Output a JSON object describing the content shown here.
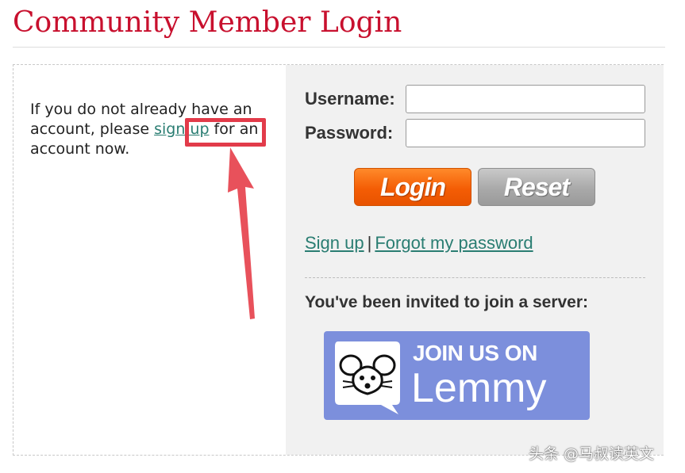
{
  "header": {
    "title": "Community Member Login"
  },
  "intro": {
    "text_before": "If you do not already have an account, please ",
    "signup_link": "sign up",
    "text_after": " for an account now."
  },
  "form": {
    "username_label": "Username:",
    "password_label": "Password:",
    "username_value": "",
    "password_value": "",
    "login_button": "Login",
    "reset_button": "Reset"
  },
  "links": {
    "signup": "Sign up",
    "separator": "|",
    "forgot": "Forgot my password"
  },
  "invite": {
    "text": "You've been invited to join a server:",
    "banner_line1": "JOIN US ON",
    "banner_line2": "Lemmy",
    "banner_icon": "lemmy-mouse-icon"
  },
  "annotation": {
    "highlight_color": "#e23b4a",
    "arrow_icon": "pointer-arrow-icon"
  },
  "watermark": {
    "text": "头条 @马叔读英文"
  },
  "colors": {
    "title": "#c8102e",
    "link": "#2a7d72",
    "login_button": "#f45d05",
    "reset_button": "#a9a9a9",
    "banner": "#7c8fdc",
    "right_panel": "#f1f1f1"
  }
}
